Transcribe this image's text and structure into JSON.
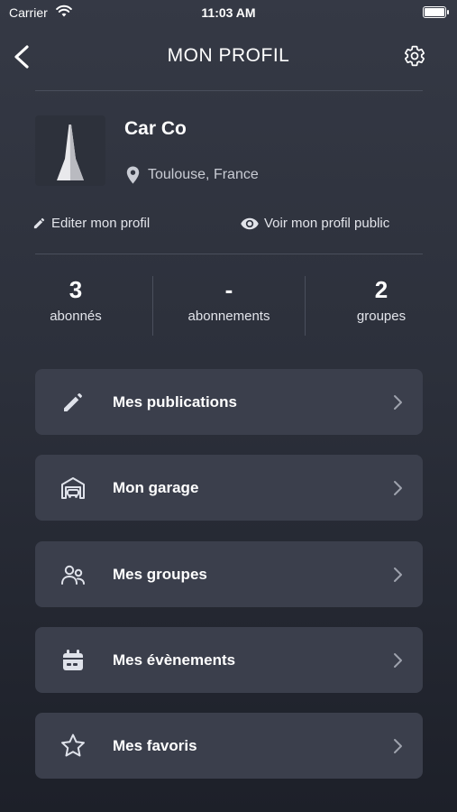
{
  "status_bar": {
    "carrier": "Carrier",
    "time": "11:03 AM"
  },
  "header": {
    "title": "MON PROFIL"
  },
  "profile": {
    "name": "Car Co",
    "location": "Toulouse, France"
  },
  "actions": {
    "edit": "Editer mon profil",
    "public": "Voir mon profil public"
  },
  "stats": [
    {
      "value": "3",
      "label": "abonnés"
    },
    {
      "value": "-",
      "label": "abonnements"
    },
    {
      "value": "2",
      "label": "groupes"
    }
  ],
  "menu": [
    {
      "label": "Mes publications",
      "icon": "pencil-icon"
    },
    {
      "label": "Mon garage",
      "icon": "garage-icon"
    },
    {
      "label": "Mes groupes",
      "icon": "users-icon"
    },
    {
      "label": "Mes évènements",
      "icon": "calendar-icon"
    },
    {
      "label": "Mes favoris",
      "icon": "star-icon"
    }
  ]
}
